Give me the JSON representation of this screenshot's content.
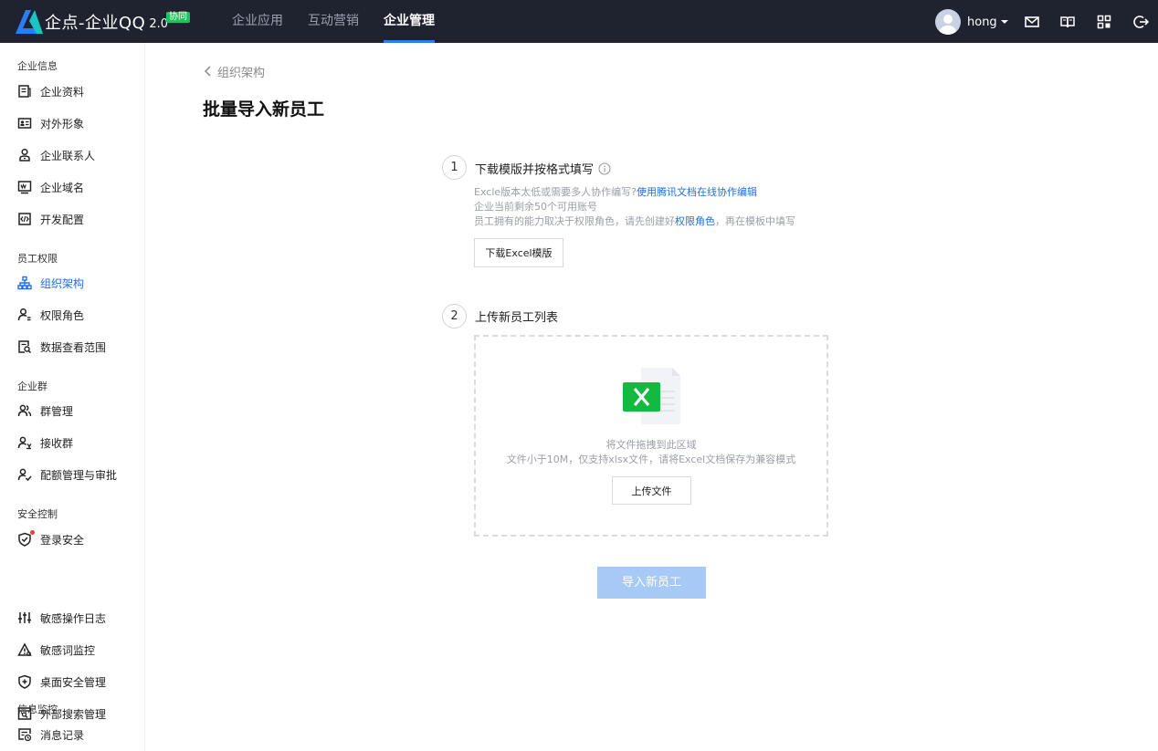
{
  "topbar": {
    "logo_text": "企点-企业QQ",
    "logo_version": "2.0",
    "logo_badge": "协同",
    "nav": [
      "企业应用",
      "互动营销",
      "企业管理"
    ],
    "active_nav": "企业管理",
    "user_name": "hong",
    "icons": [
      "mail-icon",
      "book-icon",
      "apps-grid-icon",
      "logout-icon"
    ]
  },
  "sidebar": {
    "groups": [
      {
        "title": "企业信息",
        "items": [
          {
            "label": "企业资料",
            "icon": "document-icon"
          },
          {
            "label": "对外形象",
            "icon": "id-card-icon"
          },
          {
            "label": "企业联系人",
            "icon": "contact-person-icon"
          },
          {
            "label": "企业域名",
            "icon": "domain-icon"
          },
          {
            "label": "开发配置",
            "icon": "code-icon"
          }
        ]
      },
      {
        "title": "员工权限",
        "items": [
          {
            "label": "组织架构",
            "icon": "org-tree-icon",
            "active": true
          },
          {
            "label": "权限角色",
            "icon": "role-icon"
          },
          {
            "label": "数据查看范围",
            "icon": "data-scope-icon"
          }
        ]
      },
      {
        "title": "企业群",
        "items": [
          {
            "label": "群管理",
            "icon": "group-icon"
          },
          {
            "label": "接收群",
            "icon": "receive-group-icon"
          },
          {
            "label": "配额管理与审批",
            "icon": "quota-approval-icon"
          }
        ]
      },
      {
        "title": "安全控制",
        "items": [
          {
            "label": "登录安全",
            "icon": "shield-check-icon",
            "badge_dot": true
          },
          {
            "label": "敏感操作日志",
            "icon": "sliders-icon"
          },
          {
            "label": "敏感词监控",
            "icon": "warning-triangle-icon"
          },
          {
            "label": "桌面安全管理",
            "icon": "shield-plus-icon"
          },
          {
            "label": "外部搜索管理",
            "icon": "window-search-icon"
          }
        ]
      },
      {
        "title": "信息监控",
        "items": [
          {
            "label": "消息记录",
            "icon": "message-record-icon"
          }
        ]
      }
    ]
  },
  "main": {
    "back_label": "组织架构",
    "title": "批量导入新员工",
    "step1": {
      "number": "1",
      "title": "下载模版并按格式填写",
      "note1_prefix": "Excle版本太低或需要多人协作编写?",
      "note1_link": "使用腾讯文档在线协作编辑",
      "note2": "企业当前剩余50个可用账号",
      "note3_prefix": "员工拥有的能力取决于权限角色，请先创建好",
      "note3_link": "权限角色",
      "note3_suffix": "，再在模板中填写",
      "button": "下载Excel模版"
    },
    "step2": {
      "number": "2",
      "title": "上传新员工列表",
      "drop_hint": "将文件拖拽到此区域",
      "drop_rule": "文件小于10M，仅支持xlsx文件，请将Excel文档保存为兼容模式",
      "button": "上传文件"
    },
    "submit": "导入新员工"
  },
  "colors": {
    "topbar_bg": "#1f2330",
    "accent": "#1e6ee8",
    "excel_green": "#14b93f",
    "badge_green": "#1fc25c",
    "primary_disabled": "#a7c9f5"
  }
}
